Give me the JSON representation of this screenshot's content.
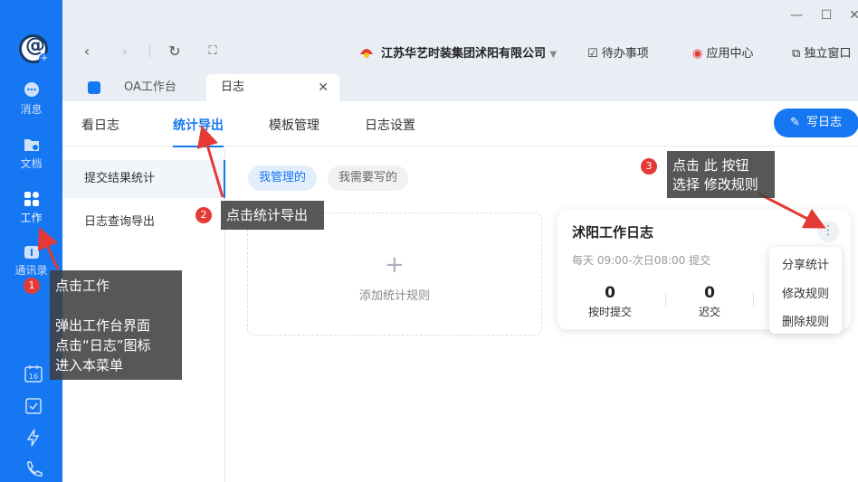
{
  "rail": {
    "items": [
      {
        "label": "消息",
        "icon": "chat-bubble-icon"
      },
      {
        "label": "文档",
        "icon": "folder-icon"
      },
      {
        "label": "工作",
        "icon": "apps-grid-icon"
      },
      {
        "label": "通讯录",
        "icon": "contacts-icon"
      }
    ],
    "calendar_day": "16"
  },
  "toolbar": {
    "company": "江苏华艺时装集团沭阳有限公司",
    "todo": "待办事项",
    "app_center": "应用中心",
    "standalone": "独立窗口"
  },
  "tabs": [
    {
      "label": "OA工作台"
    },
    {
      "label": "日志"
    }
  ],
  "nav": {
    "items": [
      "看日志",
      "统计导出",
      "模板管理",
      "日志设置"
    ],
    "write_button": "写日志"
  },
  "side": {
    "items": [
      "提交结果统计",
      "日志查询导出"
    ]
  },
  "filters": {
    "managed": "我管理的",
    "need_write": "我需要写的"
  },
  "add_card": {
    "label": "添加统计规则"
  },
  "rule_card": {
    "title": "沭阳工作日志",
    "schedule": "每天 09:00-次日08:00 提交",
    "stats": [
      {
        "value": "0",
        "label": "按时提交"
      },
      {
        "value": "0",
        "label": "迟交"
      }
    ]
  },
  "dropdown": {
    "items": [
      "分享统计",
      "修改规则",
      "删除规则"
    ]
  },
  "annotations": {
    "a1": {
      "num": "1",
      "line1": "点击工作",
      "line2": "弹出工作台界面",
      "line3": "点击“日志”图标",
      "line4": "进入本菜单"
    },
    "a2": {
      "num": "2",
      "text": "点击统计导出"
    },
    "a3": {
      "num": "3",
      "line1": "点击 此 按钮",
      "line2": "选择 修改规则"
    }
  },
  "colors": {
    "primary": "#1677f2",
    "rail": "#1677f2",
    "annotation_bg": "#404040",
    "arrow": "#e53935"
  }
}
